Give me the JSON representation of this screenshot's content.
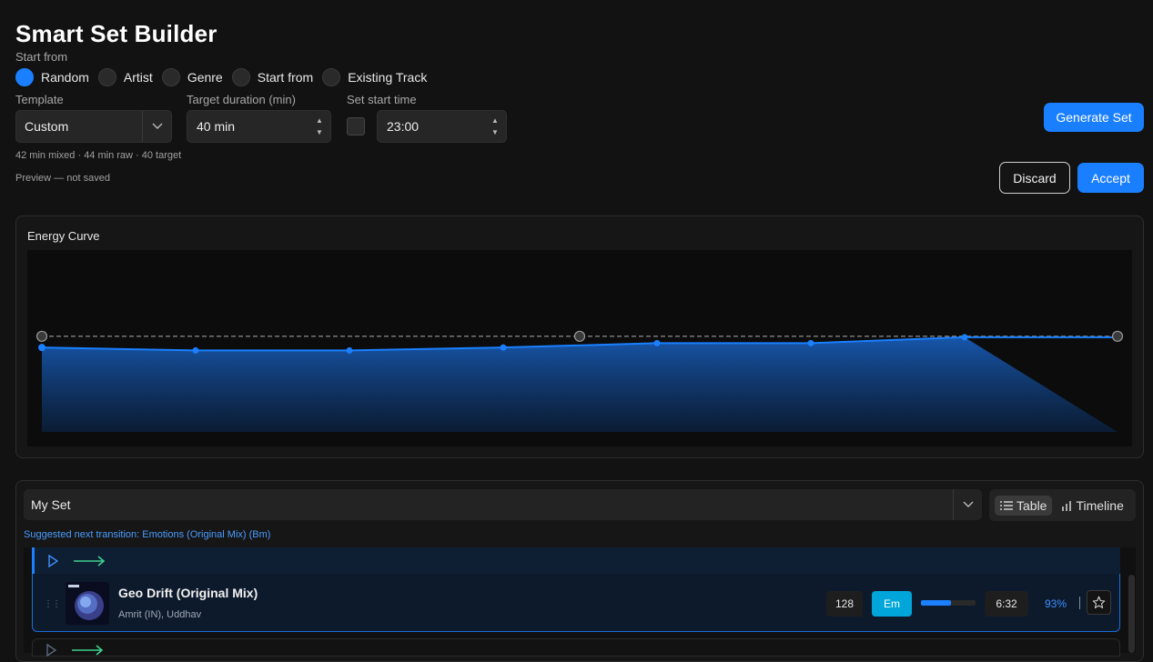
{
  "title": "Smart Set Builder",
  "start_from": {
    "label": "Start from",
    "options": [
      {
        "label": "Random",
        "selected": true
      },
      {
        "label": "Artist",
        "selected": false
      },
      {
        "label": "Genre",
        "selected": false
      },
      {
        "label": "Start from",
        "selected": false
      },
      {
        "label": "Existing Track",
        "selected": false
      }
    ]
  },
  "template": {
    "label": "Template",
    "value": "Custom"
  },
  "duration": {
    "label": "Target duration (min)",
    "value": "40 min"
  },
  "start_time": {
    "label": "Set start time",
    "value": "23:00",
    "enabled": false
  },
  "stats_text": "42 min mixed · 44 min raw · 40 target",
  "preview_text": "Preview — not saved",
  "buttons": {
    "generate": "Generate Set",
    "discard": "Discard",
    "accept": "Accept"
  },
  "energy": {
    "title": "Energy Curve",
    "curve_values": [
      0.61,
      0.59,
      0.59,
      0.61,
      0.64,
      0.64,
      0.68,
      0.68
    ],
    "target_values": [
      0.6,
      0.6,
      0.6
    ],
    "colors": {
      "line": "#1a80ff",
      "target": "#9a9a9a"
    }
  },
  "set": {
    "name": "My Set",
    "view": {
      "table": "Table",
      "timeline": "Timeline"
    },
    "suggestion": "Suggested next transition: Emotions (Original Mix) (Bm)",
    "track": {
      "title": "Geo Drift (Original Mix)",
      "artist": "Amrit (IN), Uddhav",
      "bpm": "128",
      "key": "Em",
      "energy": 0.55,
      "duration": "6:32",
      "match": "93%"
    }
  }
}
